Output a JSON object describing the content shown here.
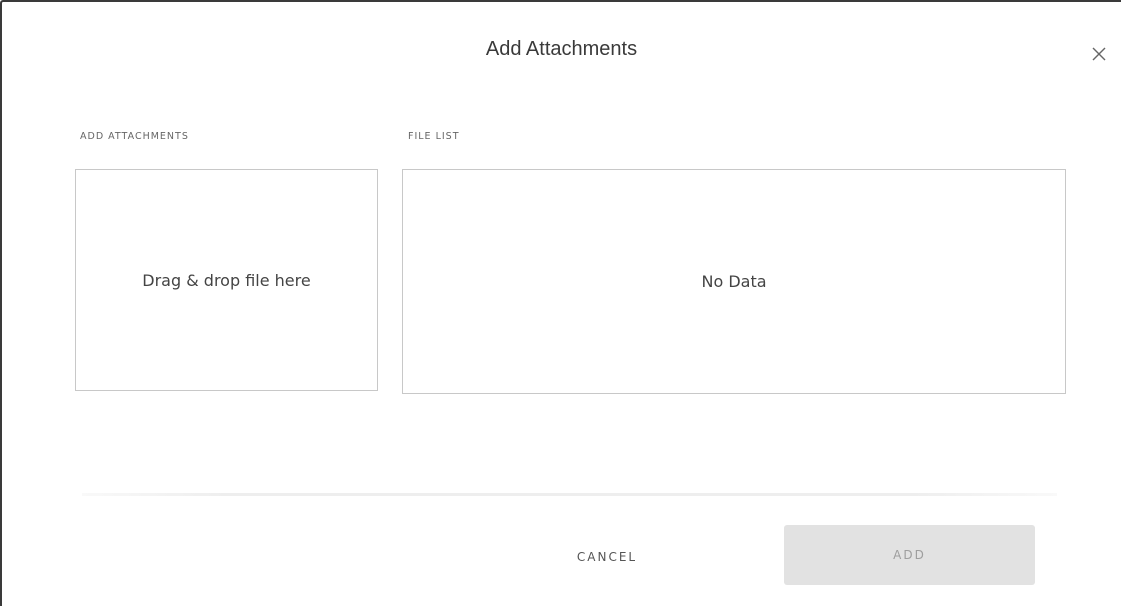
{
  "dialog": {
    "title": "Add Attachments",
    "close_icon": "close-icon"
  },
  "add_attachments": {
    "label": "ADD ATTACHMENTS",
    "dropzone_text": "Drag & drop file here"
  },
  "file_list": {
    "label": "FILE LIST",
    "empty_text": "No Data",
    "files": []
  },
  "footer": {
    "cancel_label": "CANCEL",
    "add_label": "ADD",
    "add_disabled": true
  },
  "colors": {
    "text": "#3a3a3a",
    "border": "#c8c8c8",
    "disabled_button_bg": "#e2e2e2",
    "disabled_button_text": "#9e9e9e"
  }
}
